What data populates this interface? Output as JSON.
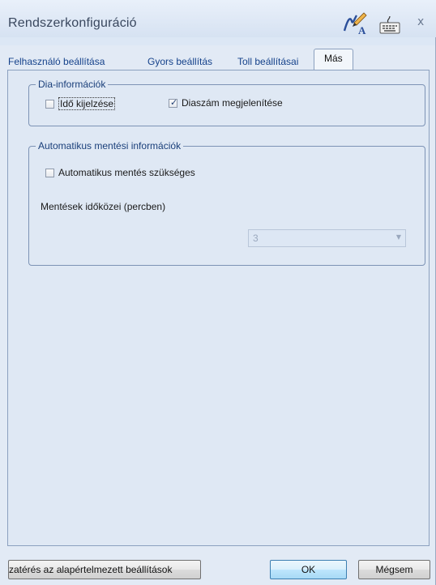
{
  "window": {
    "title": "Rendszerkonfiguráció",
    "icons": [
      "pen-icon",
      "keyboard-icon"
    ],
    "close_glyph": "x"
  },
  "tabs": [
    {
      "label": "Felhasználó beállítása",
      "active": false
    },
    {
      "label": "Gyors beállítás",
      "active": false
    },
    {
      "label": "Toll beállításai",
      "active": false
    },
    {
      "label": "Más",
      "active": true
    }
  ],
  "slide_info": {
    "legend": "Dia-információk",
    "show_time": {
      "label": "Idő kijelzése",
      "checked": false
    },
    "show_slide_number": {
      "label": "Diaszám megjelenítése",
      "checked": true
    }
  },
  "autosave": {
    "legend": "Automatikus mentési információk",
    "required": {
      "label": "Automatikus mentés szükséges",
      "checked": false
    },
    "interval_label": "Mentések időközei (percben)",
    "interval_value": "3"
  },
  "footer": {
    "reset_label": "zatérés az alapértelmezett beállítások",
    "ok_label": "OK",
    "cancel_label": "Mégsem"
  },
  "colors": {
    "accent": "#15428b",
    "panel": "#dfe8f4"
  }
}
